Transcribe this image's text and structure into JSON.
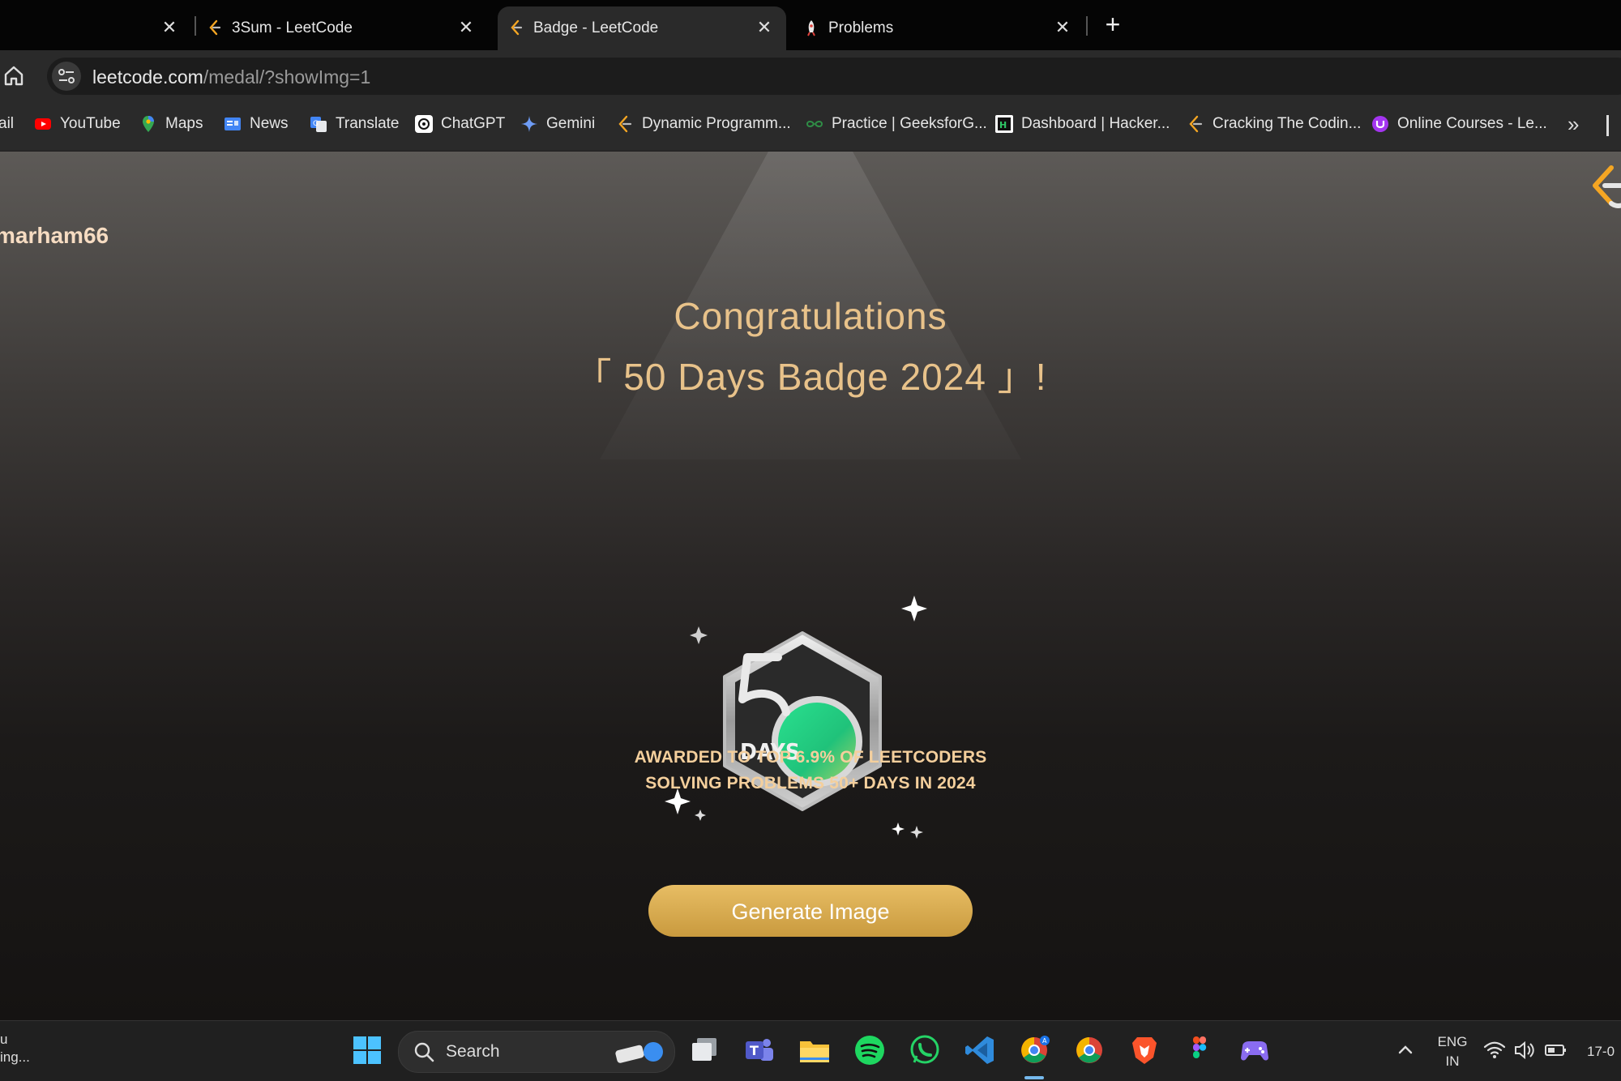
{
  "tabs": [
    {
      "title": "3Sum - LeetCode",
      "active": false
    },
    {
      "title": "Badge - LeetCode",
      "active": true
    },
    {
      "title": "Problems",
      "active": false
    }
  ],
  "new_tab_label": "+",
  "close_glyph": "✕",
  "address": {
    "host": "leetcode.com",
    "path": "/medal/?showImg=1"
  },
  "bookmarks": [
    {
      "label": "ail",
      "icon": "gmail-icon"
    },
    {
      "label": "YouTube",
      "icon": "youtube-icon"
    },
    {
      "label": "Maps",
      "icon": "maps-icon"
    },
    {
      "label": "News",
      "icon": "news-icon"
    },
    {
      "label": "Translate",
      "icon": "translate-icon"
    },
    {
      "label": "ChatGPT",
      "icon": "chatgpt-icon"
    },
    {
      "label": "Gemini",
      "icon": "gemini-icon"
    },
    {
      "label": "Dynamic Programm...",
      "icon": "leetcode-icon"
    },
    {
      "label": "Practice | GeeksforG...",
      "icon": "geeksforgeeks-icon"
    },
    {
      "label": "Dashboard | Hacker...",
      "icon": "hackerrank-icon"
    },
    {
      "label": "Cracking The Codin...",
      "icon": "leetcode-icon"
    },
    {
      "label": "Online Courses - Le...",
      "icon": "udemy-icon"
    }
  ],
  "bookmarks_more": "»",
  "page": {
    "username": "marham66",
    "title_line1": "Congratulations",
    "title_line2": "「 50 Days Badge 2024 」!",
    "badge_label": "DAYS",
    "award_line1": "AWARDED TO TOP 6.9% OF LEETCODERS",
    "award_line2": "SOLVING PROBLEMS 50+ DAYS IN 2024",
    "generate_button": "Generate Image"
  },
  "taskbar": {
    "left_info_line1": "u",
    "left_info_line2": "ing...",
    "search_label": "Search",
    "lang_line1": "ENG",
    "lang_line2": "IN",
    "clock": "17-0"
  },
  "colors": {
    "accent_gold": "#e8c28a",
    "button_gold": "#d9aa4f",
    "badge_green": "#2fd48a"
  }
}
